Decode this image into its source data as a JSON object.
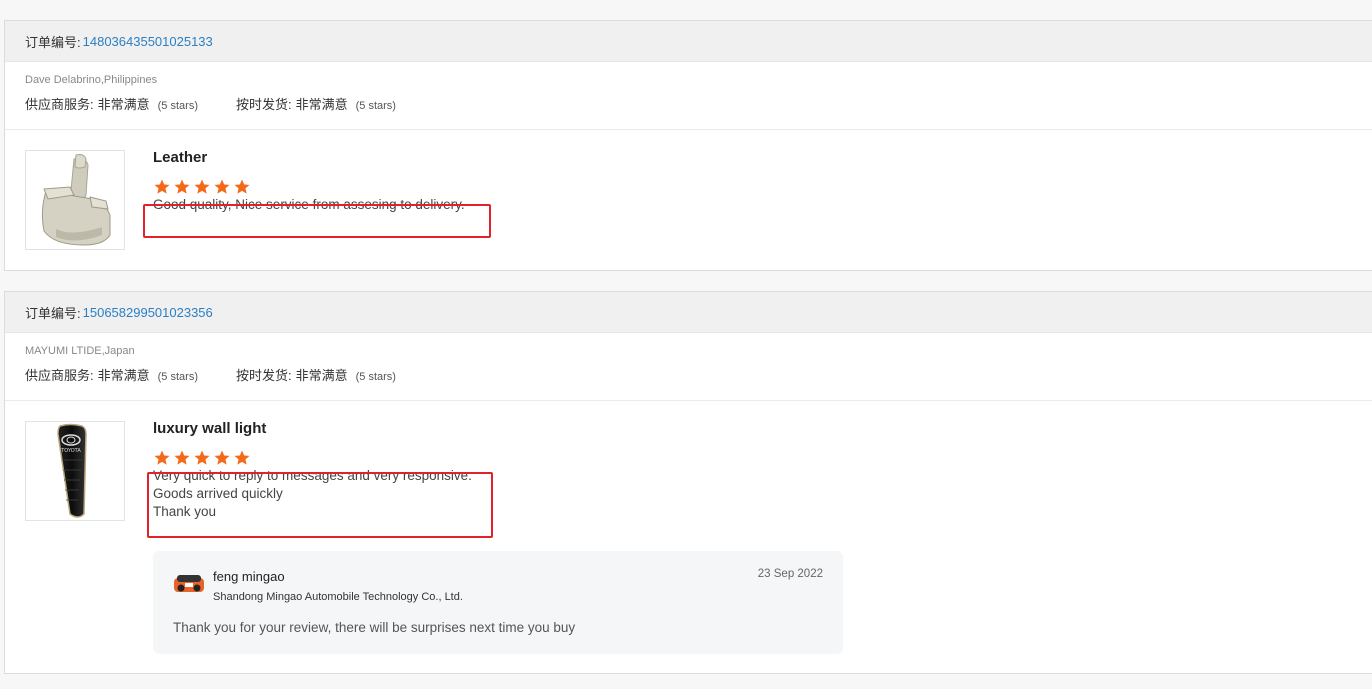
{
  "reviews": [
    {
      "order_label": "订单编号:",
      "order_number": "148036435501025133",
      "buyer": "Dave Delabrino,Philippines",
      "supplier_service_label": "供应商服务:",
      "supplier_service_value": "非常满意",
      "supplier_service_stars": "(5 stars)",
      "on_time_label": "按时发货:",
      "on_time_value": "非常满意",
      "on_time_stars": "(5 stars)",
      "product_name": "Leather",
      "product_icon": "car-seat-image",
      "rating": 5,
      "review_lines": [
        "Good quality, Nice service from assesing to delivery."
      ]
    },
    {
      "order_label": "订单编号:",
      "order_number": "150658299501023356",
      "buyer": "MAYUMI LTIDE,Japan",
      "supplier_service_label": "供应商服务:",
      "supplier_service_value": "非常满意",
      "supplier_service_stars": "(5 stars)",
      "on_time_label": "按时发货:",
      "on_time_value": "非常满意",
      "on_time_stars": "(5 stars)",
      "product_name": "luxury wall light",
      "product_icon": "toyota-wall-light-image",
      "rating": 5,
      "review_lines": [
        "Very quick to reply to messages and very responsive.",
        "Goods arrived quickly",
        "Thank you"
      ],
      "reply": {
        "name": "feng mingao",
        "company": "Shandong Mingao Automobile Technology Co., Ltd.",
        "date": "23 Sep 2022",
        "text": "Thank you for your review, there will be surprises next time you buy",
        "avatar_icon": "supplier-avatar-icon"
      }
    }
  ],
  "colors": {
    "star": "#f46a1b",
    "link": "#2b7fc4",
    "highlight": "#e0232b",
    "header_bg": "#f0f0f0",
    "reply_bg": "#f5f6f8"
  }
}
